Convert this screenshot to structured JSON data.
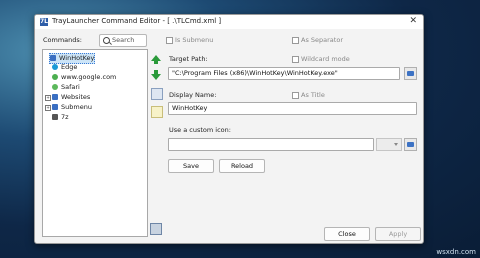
{
  "window": {
    "title": "TrayLauncher Command Editor - [ .\\TLCmd.xml ]",
    "icon_text": "7L",
    "close_glyph": "✕"
  },
  "commands_label": "Commands:",
  "search": {
    "placeholder": "Search"
  },
  "tree": [
    {
      "label": "WinHotKey",
      "icon_color": "#3a6fc2",
      "selected": true
    },
    {
      "label": "Edge",
      "icon_color": "#1a9ad6"
    },
    {
      "label": "www.google.com",
      "icon_color": "#4caf50"
    },
    {
      "label": "Safari",
      "icon_color": "#5cb85c"
    },
    {
      "label": "Websites",
      "icon_color": "#3a6fc2",
      "expander": "+"
    },
    {
      "label": "Submenu",
      "icon_color": "#3a6fc2",
      "expander": "+"
    },
    {
      "label": "7z",
      "icon_color": "#555555"
    }
  ],
  "options": {
    "is_submenu": "Is Submenu",
    "as_separator": "As Separator",
    "wildcard_mode": "Wildcard mode",
    "as_title": "As Title"
  },
  "target_path": {
    "label": "Target Path:",
    "value": "\"C:\\Program Files (x86)\\WinHotKey\\WinHotKey.exe\""
  },
  "display_name": {
    "label": "Display Name:",
    "value": "WinHotKey"
  },
  "custom_icon": {
    "label": "Use a custom icon:",
    "value": ""
  },
  "buttons": {
    "save": "Save",
    "reload": "Reload",
    "close": "Close",
    "apply": "Apply"
  },
  "watermark": "wsxdn.com"
}
